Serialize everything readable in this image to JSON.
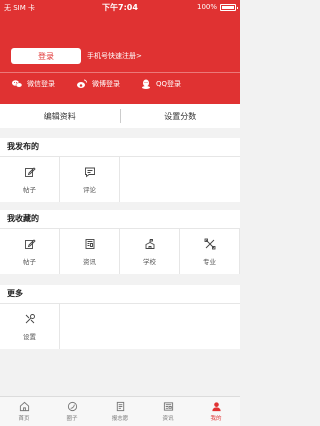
{
  "status_bar": {
    "carrier": "无 SIM 卡",
    "time": "下午7:04",
    "battery": "100%"
  },
  "header": {
    "login_label": "登录",
    "quick_register": "手机号快速注册>",
    "social": [
      {
        "label": "微信登录",
        "icon": "wechat-icon"
      },
      {
        "label": "微博登录",
        "icon": "weibo-icon"
      },
      {
        "label": "QQ登录",
        "icon": "qq-icon"
      }
    ]
  },
  "edit_bar": {
    "edit_profile": "编辑资料",
    "set_score": "设置分数"
  },
  "sections": {
    "published": {
      "title": "我发布的",
      "items": [
        {
          "label": "帖子",
          "icon": "edit-icon"
        },
        {
          "label": "评论",
          "icon": "comment-icon"
        }
      ]
    },
    "favorites": {
      "title": "我收藏的",
      "items": [
        {
          "label": "帖子",
          "icon": "edit-icon"
        },
        {
          "label": "资讯",
          "icon": "news-icon"
        },
        {
          "label": "学校",
          "icon": "school-icon"
        },
        {
          "label": "专业",
          "icon": "tools-icon"
        }
      ]
    },
    "more": {
      "title": "更多",
      "items": [
        {
          "label": "设置",
          "icon": "settings-icon"
        }
      ]
    }
  },
  "tabbar": [
    {
      "label": "首页",
      "icon": "home-icon"
    },
    {
      "label": "圈子",
      "icon": "circle-icon"
    },
    {
      "label": "报志愿",
      "icon": "apply-icon"
    },
    {
      "label": "资讯",
      "icon": "news-icon"
    },
    {
      "label": "我的",
      "icon": "profile-icon",
      "active": true
    }
  ],
  "colors": {
    "brand": "#e03232",
    "background": "#f2f2f2"
  }
}
